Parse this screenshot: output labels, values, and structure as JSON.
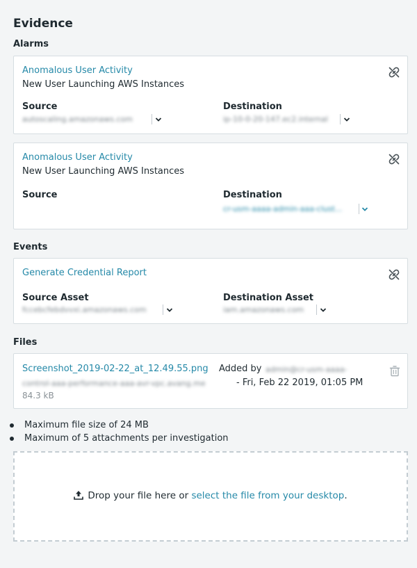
{
  "heading": "Evidence",
  "alarms": {
    "title": "Alarms",
    "items": [
      {
        "title": "Anomalous User Activity",
        "subtitle": "New User Launching AWS Instances",
        "source_label": "Source",
        "source_value": "autoscaling.amazonaws.com",
        "destination_label": "Destination",
        "destination_value": "ip-10-0-20-147.ec2.internal"
      },
      {
        "title": "Anomalous User Activity",
        "subtitle": "New User Launching AWS Instances",
        "source_label": "Source",
        "destination_label": "Destination",
        "destination_value": "cr-usm-aaaa-admin-aaa-clust..."
      }
    ]
  },
  "events": {
    "title": "Events",
    "items": [
      {
        "title": "Generate Credential Report",
        "source_label": "Source Asset",
        "source_value": "fccebcfebdvvxi.amazonaws.com",
        "destination_label": "Destination Asset",
        "destination_value": "iam.amazonaws.com"
      }
    ]
  },
  "files": {
    "title": "Files",
    "items": [
      {
        "name": "Screenshot_2019-02-22_at_12.49.55.png",
        "added_by_label": "Added by",
        "added_by_user": "admin@cr-usm-aaaa-",
        "added_by_user_cont": "control-aaa-performance-aaa-avr-vpc.avang.me",
        "date": "- Fri, Feb 22 2019, 01:05 PM",
        "size": "84.3 kB"
      }
    ]
  },
  "rules": [
    "Maximum file size of 24 MB",
    "Maximum of 5 attachments per investigation"
  ],
  "dropzone": {
    "text_before": "Drop your file here or",
    "link_text": "select the file from your desktop",
    "text_after": "."
  },
  "colors": {
    "accent": "#2589a8",
    "text": "#1f2a30",
    "border": "#d6dde1",
    "background": "#f3f5f6"
  },
  "icons": {
    "unlink": "unlink-icon",
    "chevron": "chevron-down-icon",
    "trash": "trash-icon",
    "upload": "upload-icon"
  }
}
